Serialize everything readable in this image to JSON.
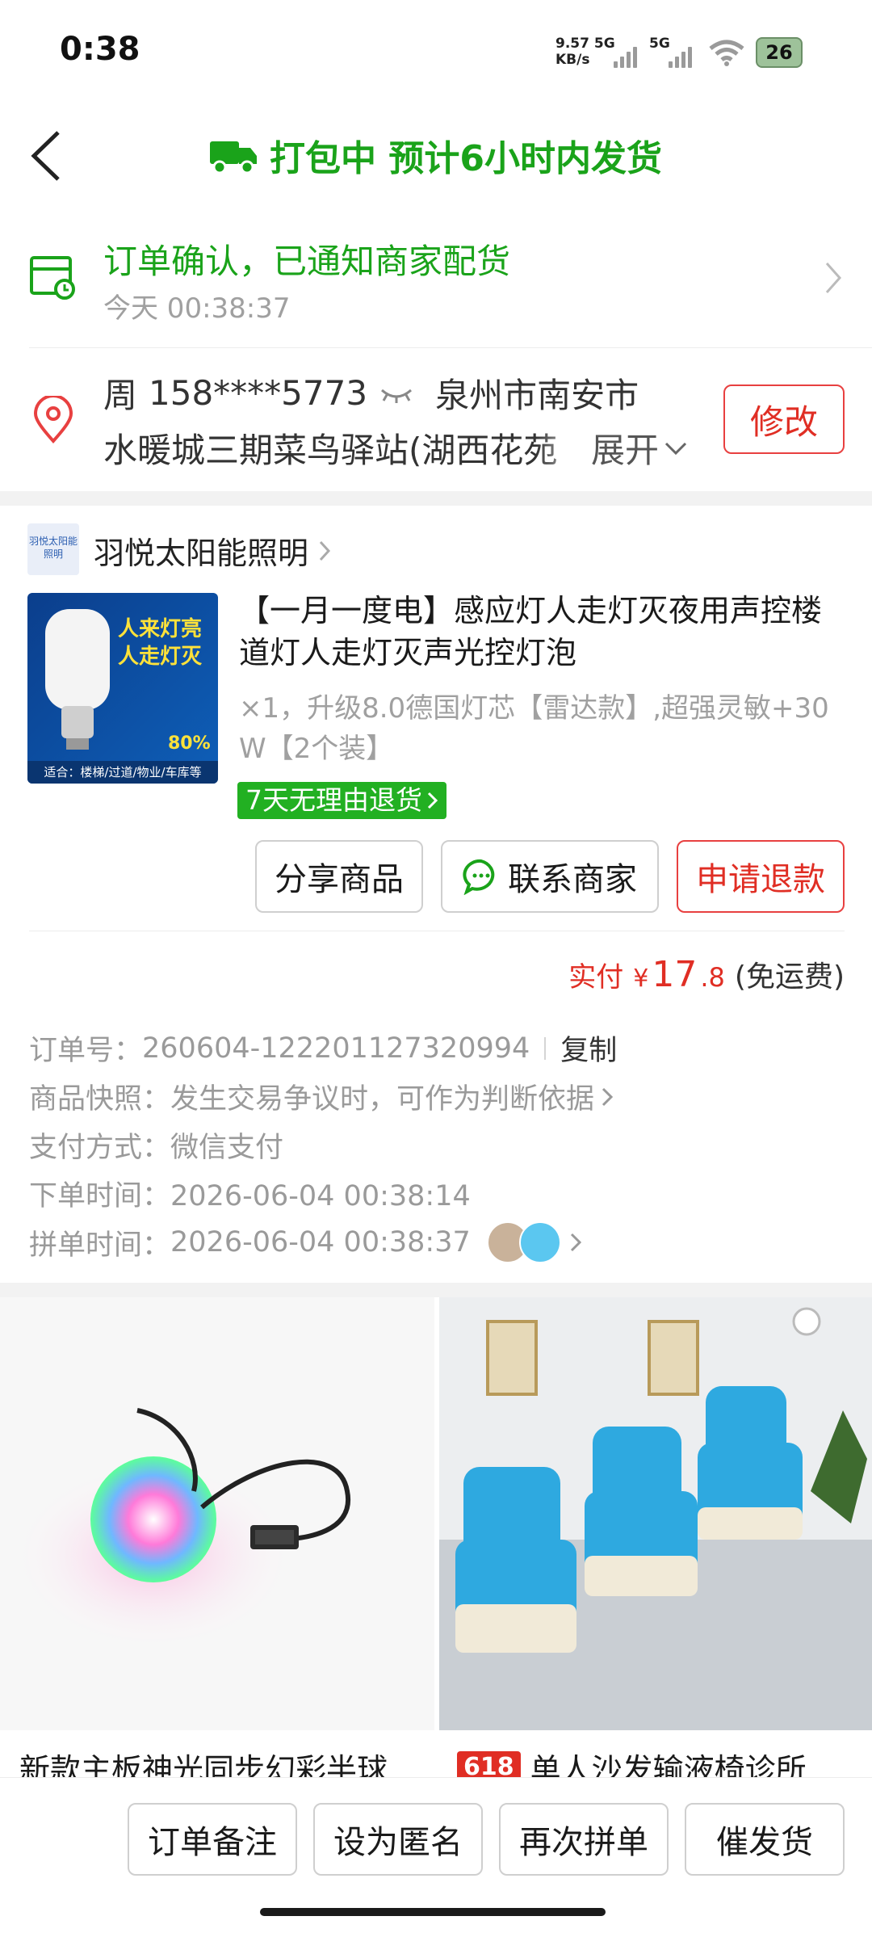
{
  "status_bar": {
    "time": "0:38",
    "net_speed": "9.57",
    "net_unit": "KB/s",
    "sim1": "5G",
    "sim2": "5G",
    "battery": "26"
  },
  "header": {
    "title": "打包中 预计6小时内发货"
  },
  "order_status": {
    "title": "订单确认，已通知商家配货",
    "time": "今天 00:38:37"
  },
  "address": {
    "name": "周",
    "phone": "158****5773",
    "city": "泉州市南安市",
    "detail": "水暖城三期菜鸟驿站(湖西花苑",
    "expand_label": "展开",
    "edit_label": "修改"
  },
  "store": {
    "logo_text": "羽悦太阳能照明",
    "name": "羽悦太阳能照明"
  },
  "product": {
    "title": "【一月一度电】感应灯人走灯灭夜用声控楼道灯人走灯灭声光控灯泡",
    "spec": "×1，升级8.0德国灯芯【雷达款】,超强灵敏+30W【2个装】",
    "badge": "7天无理由退货",
    "image_text_1": "人来灯亮",
    "image_text_2": "人走灯灭",
    "image_percent": "80%",
    "image_footer": "适合：楼梯/过道/物业/车库等"
  },
  "actions": {
    "share": "分享商品",
    "contact": "联系商家",
    "refund": "申请退款"
  },
  "payment": {
    "label": "实付",
    "currency": "¥",
    "integer": "17",
    "decimal": ".8",
    "shipping": "(免运费)"
  },
  "order_info": {
    "order_no_label": "订单号：",
    "order_no": "260604-122201127320994",
    "copy_label": "复制",
    "snapshot_label": "商品快照：",
    "snapshot_value": "发生交易争议时，可作为判断依据",
    "pay_method_label": "支付方式：",
    "pay_method": "微信支付",
    "order_time_label": "下单时间：",
    "order_time": "2026-06-04 00:38:14",
    "group_time_label": "拼单时间：",
    "group_time": "2026-06-04 00:38:37"
  },
  "recommendations": [
    {
      "title": "新款主板神光同步幻彩半球",
      "tag": ""
    },
    {
      "title": "单人沙发输液椅诊所",
      "tag": "618"
    }
  ],
  "bottom_bar": {
    "note": "订单备注",
    "anonymous": "设为匿名",
    "regroup": "再次拼单",
    "urge": "催发货"
  },
  "colors": {
    "green": "#1aa31a",
    "red": "#e02e24",
    "gray": "#999999"
  }
}
